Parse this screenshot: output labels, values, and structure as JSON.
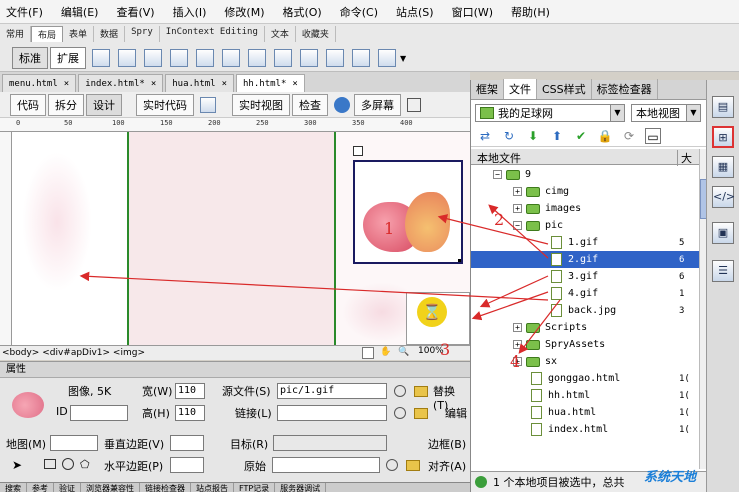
{
  "menubar": [
    "文件(F)",
    "编辑(E)",
    "查看(V)",
    "插入(I)",
    "修改(M)",
    "格式(O)",
    "命令(C)",
    "站点(S)",
    "窗口(W)",
    "帮助(H)"
  ],
  "insert_tabs": [
    "常用",
    "布局",
    "表单",
    "数据",
    "Spry",
    "InContext Editing",
    "文本",
    "收藏夹"
  ],
  "insert_active_tab": "布局",
  "layout_buttons": [
    "标准",
    "扩展"
  ],
  "doc_tabs": [
    {
      "label": "menu.html"
    },
    {
      "label": "index.html*"
    },
    {
      "label": "hua.html"
    },
    {
      "label": "hh.html*",
      "active": true
    }
  ],
  "view_buttons": [
    "代码",
    "拆分",
    "设计",
    "实时代码",
    "实时视图",
    "检查",
    "多屏幕"
  ],
  "ruler_marks": [
    "0",
    "50",
    "100",
    "150",
    "200",
    "250",
    "300",
    "350",
    "400"
  ],
  "tag_selector": "<body> <div#apDiv1> <img>",
  "zoom": "100%",
  "properties": {
    "title": "属性",
    "image_label": "图像, 5K",
    "width_label": "宽(W)",
    "width_value": "110",
    "height_label": "高(H)",
    "height_value": "110",
    "src_label": "源文件(S)",
    "src_value": "pic/1.gif",
    "alt_label": "替换(T)",
    "link_label": "链接(L)",
    "edit_label": "编辑",
    "id_label": "ID",
    "map_label": "地图(M)",
    "vspace_label": "垂直边距(V)",
    "hspace_label": "水平边距(P)",
    "target_label": "目标(R)",
    "original_label": "原始",
    "border_label": "边框(B)",
    "align_label": "对齐(A)"
  },
  "bottom_tabs": [
    "搜索",
    "参考",
    "验证",
    "浏览器兼容性",
    "链接检查器",
    "站点报告",
    "FTP记录",
    "服务器调试"
  ],
  "files_panel": {
    "tabs": [
      "框架",
      "文件",
      "CSS样式",
      "标签检查器"
    ],
    "active_tab": "文件",
    "site": "我的足球网",
    "view": "本地视图",
    "header_name": "本地文件",
    "header_size": "大",
    "status": "1 个本地项目被选中，总共",
    "tree": [
      {
        "name": "9",
        "type": "folder",
        "level": 1,
        "expanded": true
      },
      {
        "name": "cimg",
        "type": "folder",
        "level": 2
      },
      {
        "name": "images",
        "type": "folder",
        "level": 2
      },
      {
        "name": "pic",
        "type": "folder",
        "level": 2,
        "expanded": true
      },
      {
        "name": "1.gif",
        "type": "file",
        "level": 3,
        "size": "5"
      },
      {
        "name": "2.gif",
        "type": "file",
        "level": 3,
        "size": "6",
        "selected": true
      },
      {
        "name": "3.gif",
        "type": "file",
        "level": 3,
        "size": "6"
      },
      {
        "name": "4.gif",
        "type": "file",
        "level": 3,
        "size": "1"
      },
      {
        "name": "back.jpg",
        "type": "file",
        "level": 3,
        "size": "3"
      },
      {
        "name": "Scripts",
        "type": "folder",
        "level": 2
      },
      {
        "name": "SpryAssets",
        "type": "folder",
        "level": 2
      },
      {
        "name": "sx",
        "type": "folder",
        "level": 2
      },
      {
        "name": "gonggao.html",
        "type": "file",
        "level": 2,
        "size": "1("
      },
      {
        "name": "hh.html",
        "type": "file",
        "level": 2,
        "size": "1("
      },
      {
        "name": "hua.html",
        "type": "file",
        "level": 2,
        "size": "1("
      },
      {
        "name": "index.html",
        "type": "file",
        "level": 2,
        "size": "1("
      }
    ]
  },
  "annotations": [
    "1",
    "2",
    "3",
    "4"
  ],
  "watermark": "系统天地",
  "colors": {
    "accent": "#2f63c7",
    "annotation": "#d92a2a"
  }
}
